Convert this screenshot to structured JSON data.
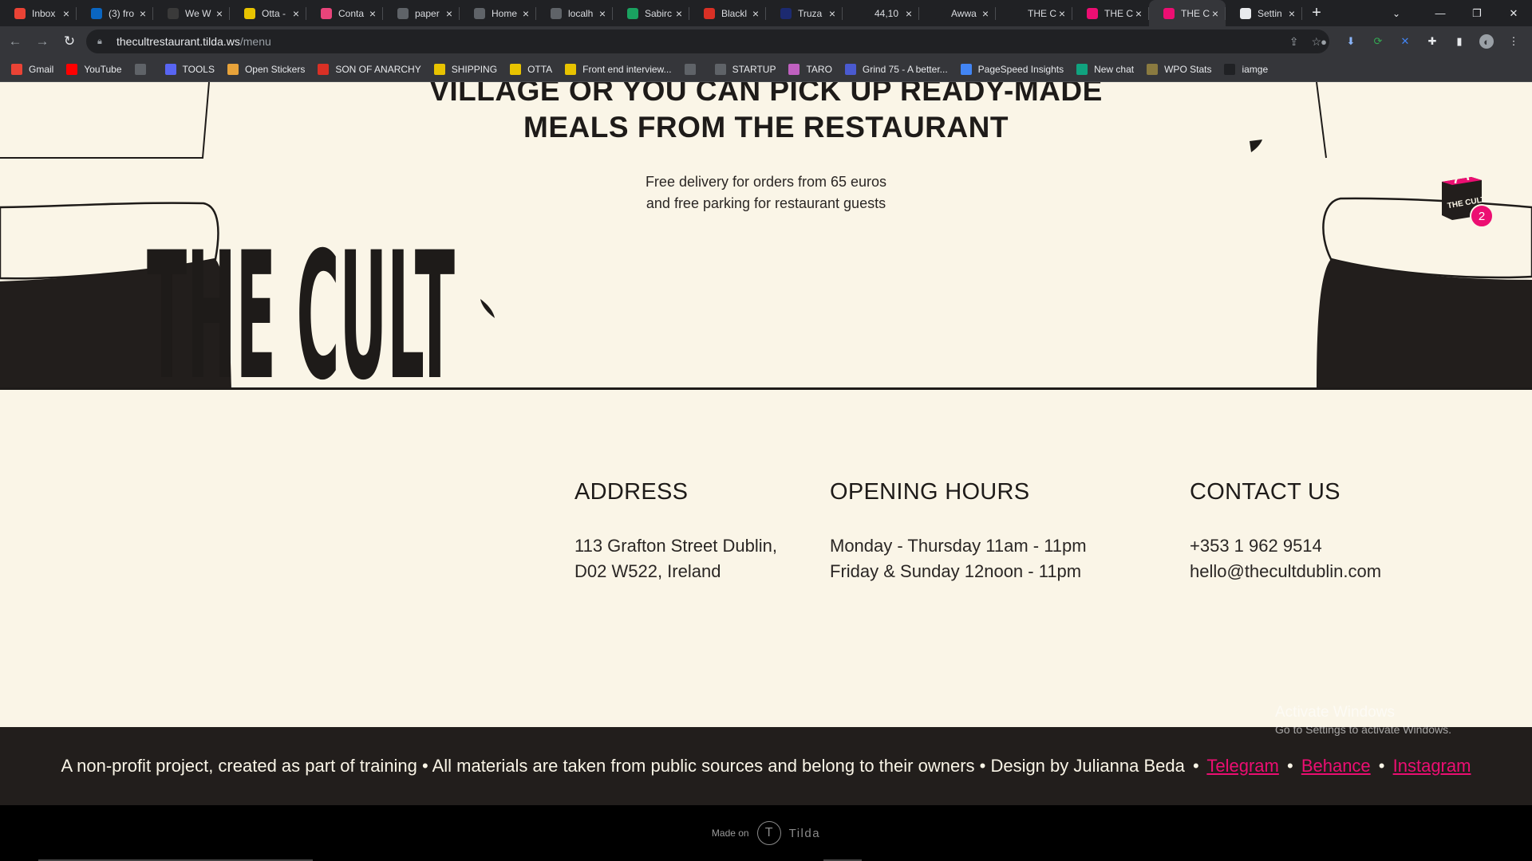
{
  "browser": {
    "tabs": [
      {
        "title": "Inbox",
        "icon": "gmail-icon",
        "color": "#ea4335"
      },
      {
        "title": "(3) fro",
        "icon": "linkedin-icon",
        "color": "#0a66c2"
      },
      {
        "title": "We W",
        "icon": "weworkremotely-icon",
        "color": "#3a3a3a"
      },
      {
        "title": "Otta -",
        "icon": "otta-icon",
        "color": "#e8c300"
      },
      {
        "title": "Conta",
        "icon": "contact-icon",
        "color": "#e8447a"
      },
      {
        "title": "paper",
        "icon": "globe-icon",
        "color": "#5f6368"
      },
      {
        "title": "Home",
        "icon": "github-icon",
        "color": "#5f6368"
      },
      {
        "title": "localh",
        "icon": "globe-icon",
        "color": "#5f6368"
      },
      {
        "title": "Sabirc",
        "icon": "maps-pin-icon",
        "color": "#1aa260"
      },
      {
        "title": "Blackl",
        "icon": "blacklist-icon",
        "color": "#d93025"
      },
      {
        "title": "Truza",
        "icon": "truzan-icon",
        "color": "#1c2a70"
      },
      {
        "title": "44,10",
        "icon": "is-icon",
        "color": "#202124"
      },
      {
        "title": "Awwa",
        "icon": "awwwards-icon",
        "color": "#202124"
      },
      {
        "title": "THE C",
        "icon": "awwwards-icon",
        "color": "#202124"
      },
      {
        "title": "THE C",
        "icon": "tilda-icon",
        "color": "#ec0e72"
      },
      {
        "title": "THE C",
        "icon": "tilda-icon",
        "color": "#ec0e72"
      },
      {
        "title": "Settin",
        "icon": "gear-icon",
        "color": "#e8eaed"
      }
    ],
    "active_tab_index": 15,
    "new_tab": "+",
    "url_host": "thecultrestaurant.tilda.ws",
    "url_path": "/menu",
    "bookmarks": [
      {
        "label": "Gmail",
        "icon": "gmail-icon",
        "color": "#ea4335"
      },
      {
        "label": "YouTube",
        "icon": "youtube-icon",
        "color": "#ff0000"
      },
      {
        "label": "",
        "icon": "globe-icon",
        "color": "#5f6368"
      },
      {
        "label": "TOOLS",
        "icon": "folder-icon",
        "color": "#5865f2"
      },
      {
        "label": "Open Stickers",
        "icon": "sticker-icon",
        "color": "#e8a33a"
      },
      {
        "label": "SON OF ANARCHY",
        "icon": "flag-icon",
        "color": "#d93025"
      },
      {
        "label": "SHIPPING",
        "icon": "chevrons-icon",
        "color": "#e8c300"
      },
      {
        "label": "OTTA",
        "icon": "otta-icon",
        "color": "#e8c300"
      },
      {
        "label": "Front end interview...",
        "icon": "bookmark-icon",
        "color": "#e8c300"
      },
      {
        "label": "",
        "icon": "globe-icon",
        "color": "#5f6368"
      },
      {
        "label": "STARTUP",
        "icon": "list-icon",
        "color": "#5f6368"
      },
      {
        "label": "TARO",
        "icon": "gift-icon",
        "color": "#c060c0"
      },
      {
        "label": "Grind 75 - A better...",
        "icon": "grind-icon",
        "color": "#4a5ad0"
      },
      {
        "label": "PageSpeed Insights",
        "icon": "pagespeed-icon",
        "color": "#4285f4"
      },
      {
        "label": "New chat",
        "icon": "chatgpt-icon",
        "color": "#10a37f"
      },
      {
        "label": "WPO Stats",
        "icon": "wpo-icon",
        "color": "#8a7a40"
      },
      {
        "label": "iamge",
        "icon": "is-icon",
        "color": "#202124"
      }
    ]
  },
  "hero": {
    "headline_line1": "VILLAGE OR YOU CAN PICK UP READY-MADE",
    "headline_line2": "MEALS FROM THE RESTAURANT",
    "delivery_line1": "Free delivery for orders from 65 euros",
    "delivery_line2": "and free parking for restaurant guests"
  },
  "cart": {
    "count": "2",
    "bag_label": "THE CULT",
    "badge_color": "#ec0e72"
  },
  "footer": {
    "logo_text": "THE CULT",
    "address": {
      "title": "ADDRESS",
      "line1": "113 Grafton Street Dublin,",
      "line2": "D02 W522, Ireland"
    },
    "hours": {
      "title": "OPENING HOURS",
      "line1": "Monday - Thursday 11am - 11pm",
      "line2": "Friday & Sunday 12noon - 11pm"
    },
    "contact": {
      "title": "CONTACT US",
      "phone": "+353 1 962 9514",
      "email": "hello@thecultdublin.com"
    }
  },
  "credits": {
    "text": "A non-profit project, created as part of training • All materials are taken from public sources and belong to their owners • Design by Julianna Beda",
    "sep": "•",
    "telegram": "Telegram",
    "behance": "Behance",
    "instagram": "Instagram",
    "link_color": "#ec0e72"
  },
  "made_on": {
    "prefix": "Made on",
    "brand": "Tilda"
  },
  "windows_watermark": {
    "line1": "Activate Windows",
    "line2": "Go to Settings to activate Windows."
  },
  "colors": {
    "cream": "#faf5e7",
    "dark": "#1e1b19",
    "pink": "#ec0e72"
  }
}
